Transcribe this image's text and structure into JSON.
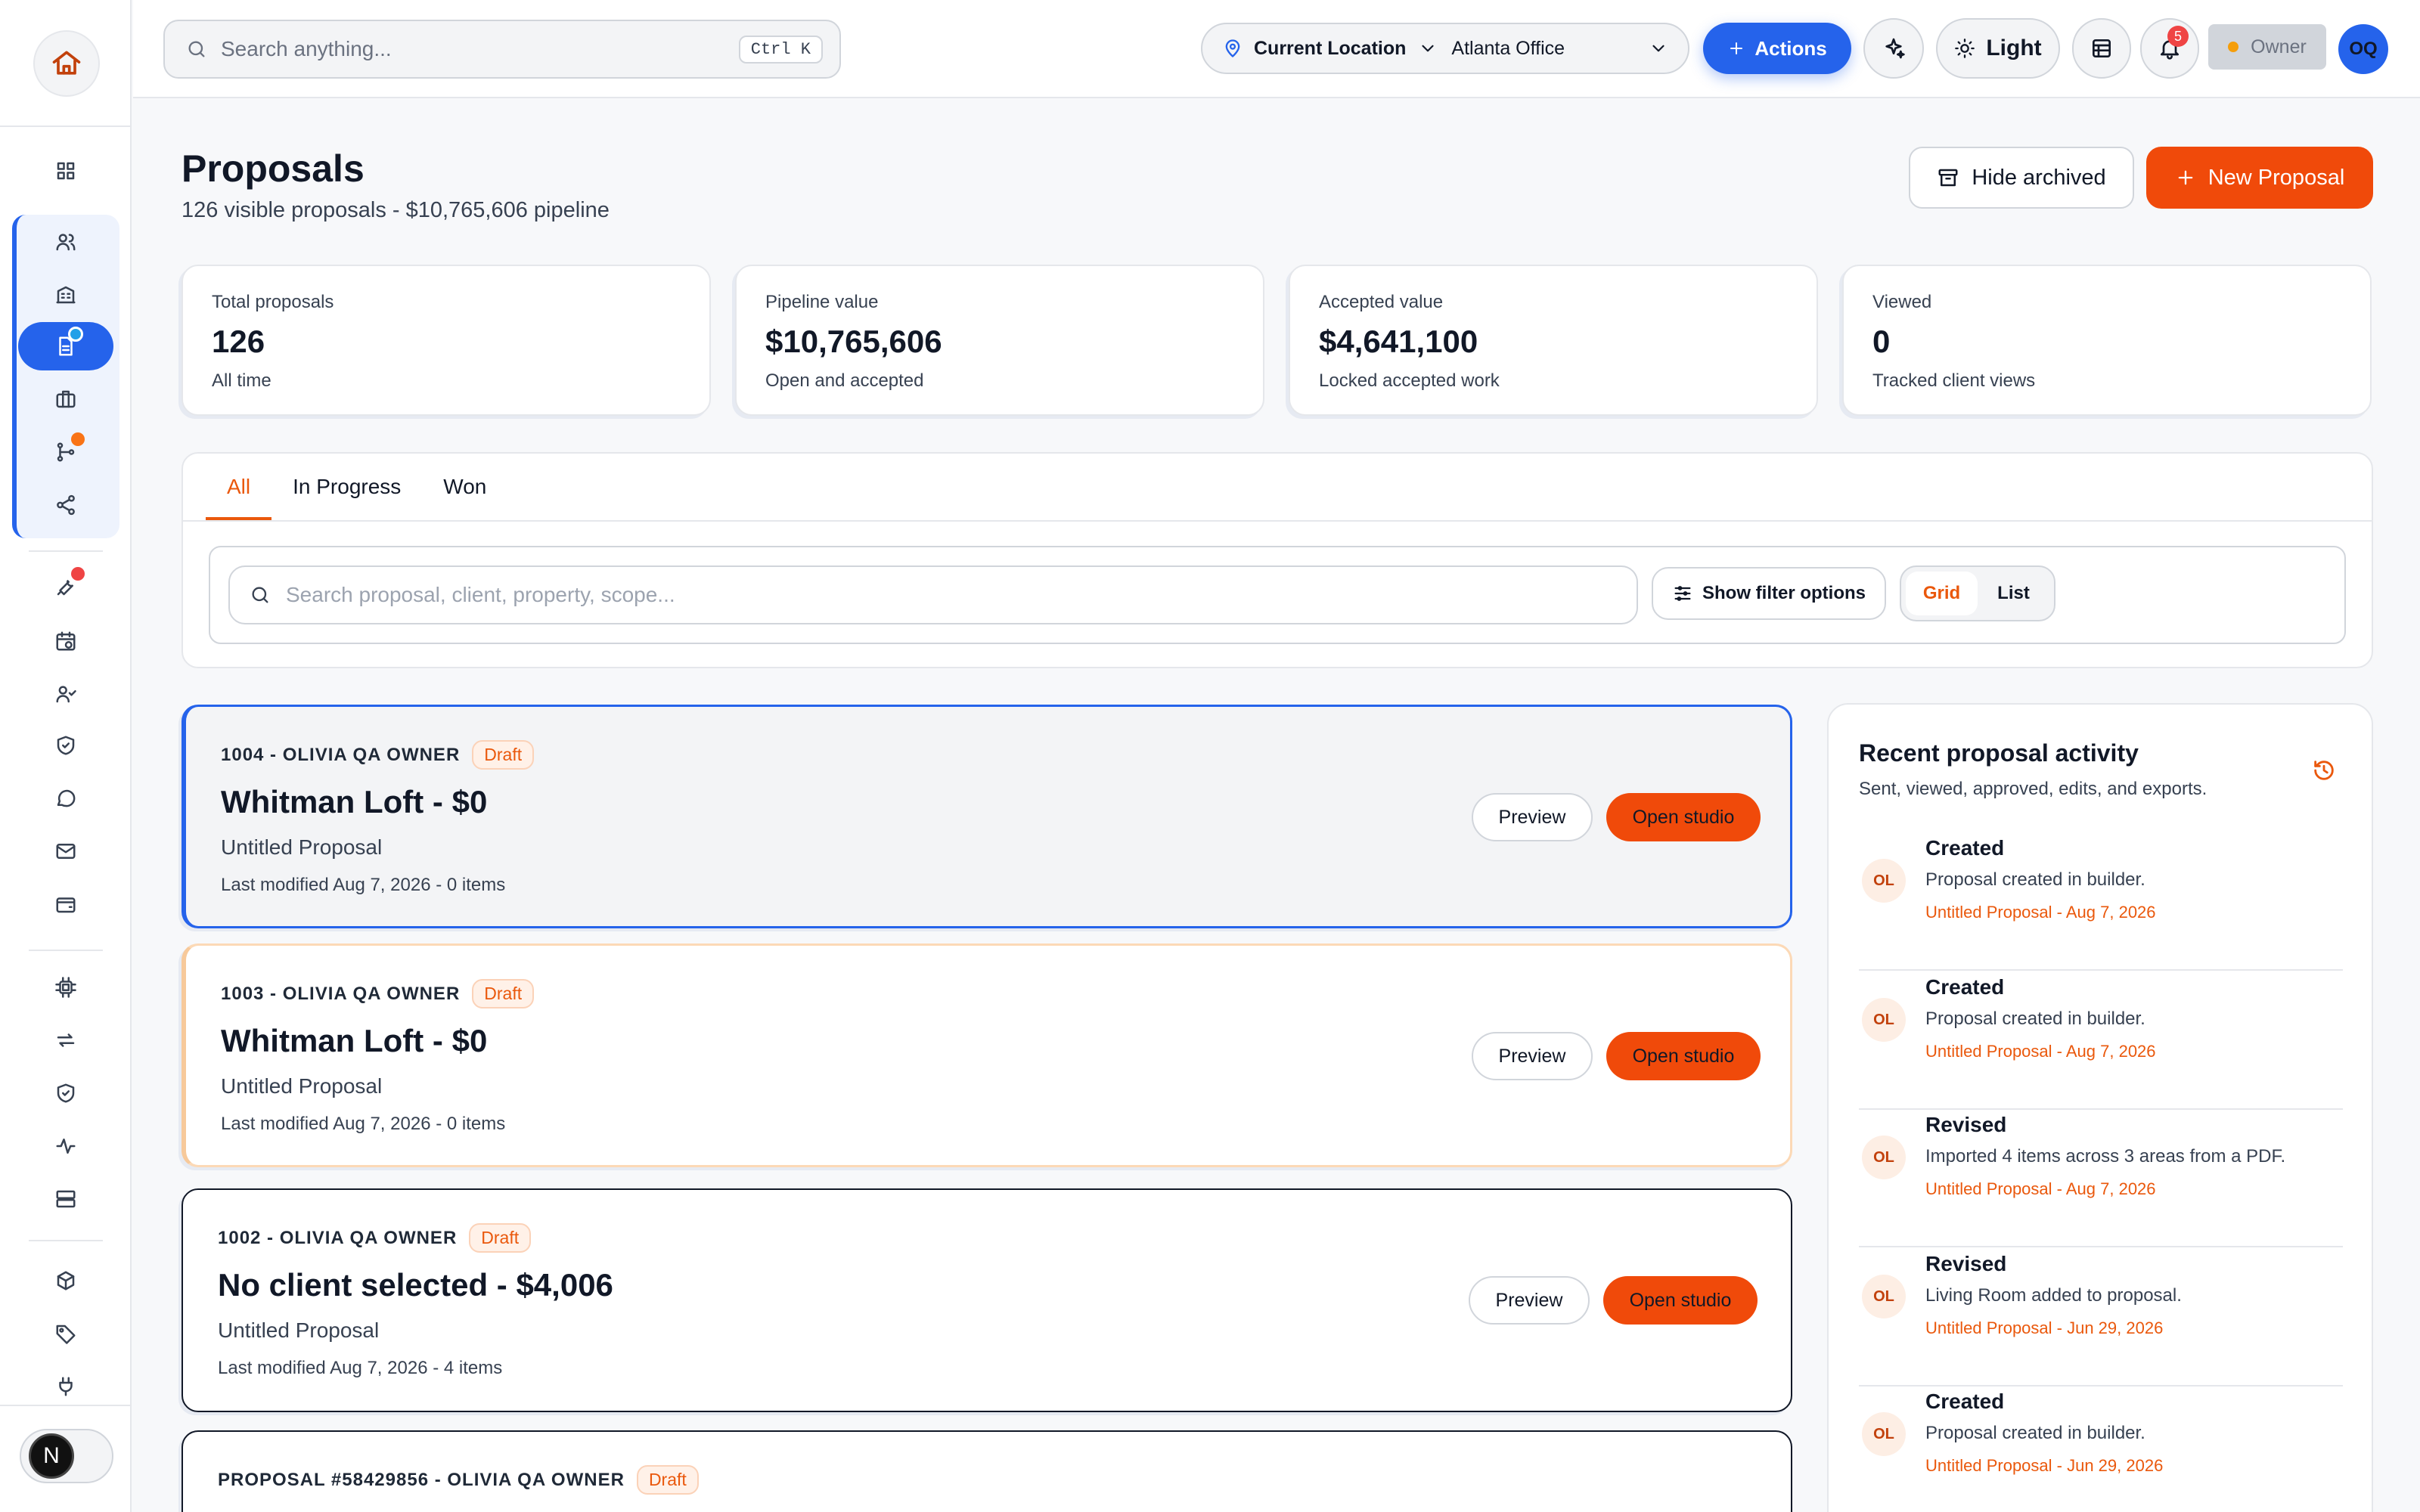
{
  "header": {
    "search_placeholder": "Search anything...",
    "search_shortcut": "Ctrl K",
    "location_label": "Current Location",
    "location_value": "Atlanta Office",
    "actions_label": "Actions",
    "theme_label": "Light",
    "notification_count": "5",
    "role_label": "Owner",
    "avatar_initials": "OQ"
  },
  "sidebar": {
    "bottom_badge": "N",
    "accent_color": "#2563eb"
  },
  "page": {
    "title": "Proposals",
    "subtitle": "126 visible proposals - $10,765,606 pipeline",
    "hide_archived_label": "Hide archived",
    "new_proposal_label": "New Proposal"
  },
  "stats": [
    {
      "label": "Total proposals",
      "value": "126",
      "note": "All time"
    },
    {
      "label": "Pipeline value",
      "value": "$10,765,606",
      "note": "Open and accepted"
    },
    {
      "label": "Accepted value",
      "value": "$4,641,100",
      "note": "Locked accepted work"
    },
    {
      "label": "Viewed",
      "value": "0",
      "note": "Tracked client views"
    }
  ],
  "tabs": [
    {
      "label": "All",
      "active": true
    },
    {
      "label": "In Progress",
      "active": false
    },
    {
      "label": "Won",
      "active": false
    }
  ],
  "filters": {
    "search_placeholder": "Search proposal, client, property, scope...",
    "filter_button": "Show filter options",
    "view_grid": "Grid",
    "view_list": "List",
    "active_view": "Grid"
  },
  "proposals": [
    {
      "meta": "1004 - OLIVIA QA OWNER",
      "status": "Draft",
      "title": "Whitman Loft - $0",
      "name": "Untitled Proposal",
      "modified": "Last modified Aug 7, 2026 - 0 items",
      "preview": "Preview",
      "open": "Open studio"
    },
    {
      "meta": "1003 - OLIVIA QA OWNER",
      "status": "Draft",
      "title": "Whitman Loft - $0",
      "name": "Untitled Proposal",
      "modified": "Last modified Aug 7, 2026 - 0 items",
      "preview": "Preview",
      "open": "Open studio"
    },
    {
      "meta": "1002 - OLIVIA QA OWNER",
      "status": "Draft",
      "title": "No client selected - $4,006",
      "name": "Untitled Proposal",
      "modified": "Last modified Aug 7, 2026 - 4 items",
      "preview": "Preview",
      "open": "Open studio"
    },
    {
      "meta": "PROPOSAL #58429856 - OLIVIA QA OWNER",
      "status": "Draft",
      "title": "",
      "name": "",
      "modified": "",
      "preview": "",
      "open": ""
    }
  ],
  "activity": {
    "title": "Recent proposal activity",
    "subtitle": "Sent, viewed, approved, edits, and exports.",
    "items": [
      {
        "initials": "OL",
        "action": "Created",
        "desc": "Proposal created in builder.",
        "ref": "Untitled Proposal - Aug 7, 2026"
      },
      {
        "initials": "OL",
        "action": "Created",
        "desc": "Proposal created in builder.",
        "ref": "Untitled Proposal - Aug 7, 2026"
      },
      {
        "initials": "OL",
        "action": "Revised",
        "desc": "Imported 4 items across 3 areas from a PDF.",
        "ref": "Untitled Proposal - Aug 7, 2026"
      },
      {
        "initials": "OL",
        "action": "Revised",
        "desc": "Living Room added to proposal.",
        "ref": "Untitled Proposal - Jun 29, 2026"
      },
      {
        "initials": "OL",
        "action": "Created",
        "desc": "Proposal created in builder.",
        "ref": "Untitled Proposal - Jun 29, 2026"
      }
    ]
  }
}
